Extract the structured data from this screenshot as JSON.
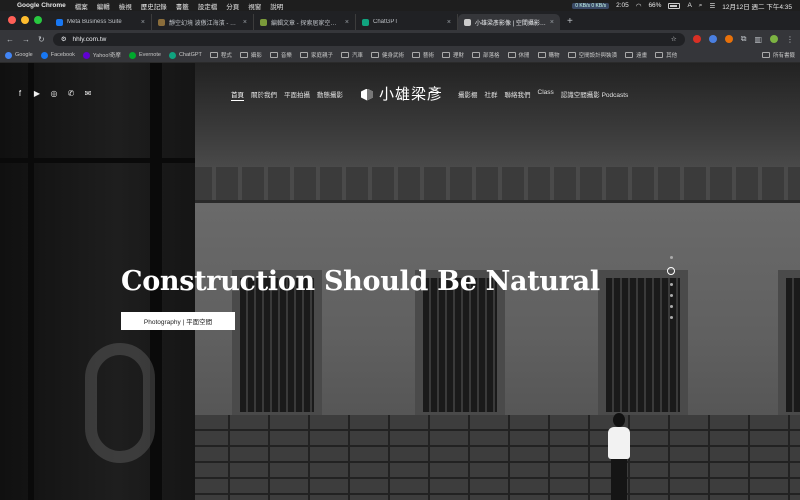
{
  "menubar": {
    "apple": "",
    "app": "Google Chrome",
    "items": [
      "檔案",
      "編輯",
      "檢視",
      "歷史記錄",
      "書籤",
      "設定檔",
      "分頁",
      "視窗",
      "說明"
    ],
    "net_speed": "0 KB/s 0 KB/s",
    "time_short": "2:05",
    "battery": "66%",
    "input_method": "A",
    "clock": "12月12日 週二 下午4:35"
  },
  "tabs": [
    {
      "title": "Meta Business Suite",
      "color": "#1877f2",
      "active": false
    },
    {
      "title": "靜空幻境 波傲江海濱 - 國內外...",
      "color": "#8a6d3b",
      "active": false
    },
    {
      "title": "編輯文章 - 探索居家空間攝影...",
      "color": "#7a9a3a",
      "active": false
    },
    {
      "title": "ChatGPT",
      "color": "#10a37f",
      "active": false
    },
    {
      "title": "小雄梁彥影像 | 空間攝影 | 室內...",
      "color": "#cccccc",
      "active": true
    }
  ],
  "omnibox": {
    "url": "hhly.com.tw"
  },
  "bookmarks": [
    {
      "label": "Google",
      "kind": "site",
      "color": "#4285f4"
    },
    {
      "label": "Facebook",
      "kind": "site",
      "color": "#1877f2"
    },
    {
      "label": "Yahoo!奇摩",
      "kind": "site",
      "color": "#6001d2"
    },
    {
      "label": "Evernote",
      "kind": "site",
      "color": "#00a82d"
    },
    {
      "label": "ChatGPT",
      "kind": "site",
      "color": "#10a37f"
    },
    {
      "label": "程式",
      "kind": "folder"
    },
    {
      "label": "攝影",
      "kind": "folder"
    },
    {
      "label": "音樂",
      "kind": "folder"
    },
    {
      "label": "家庭親子",
      "kind": "folder"
    },
    {
      "label": "汽車",
      "kind": "folder"
    },
    {
      "label": "健身武術",
      "kind": "folder"
    },
    {
      "label": "藝術",
      "kind": "folder"
    },
    {
      "label": "理財",
      "kind": "folder"
    },
    {
      "label": "部落格",
      "kind": "folder"
    },
    {
      "label": "休閒",
      "kind": "folder"
    },
    {
      "label": "購物",
      "kind": "folder"
    },
    {
      "label": "空間設計與裝潢",
      "kind": "folder"
    },
    {
      "label": "遠畫",
      "kind": "folder"
    },
    {
      "label": "其他",
      "kind": "folder"
    }
  ],
  "bookmarks_right": "所有書籤",
  "site": {
    "nav_left": [
      "首頁",
      "關於我們",
      "平面拍攝",
      "動態攝影"
    ],
    "nav_right": [
      "攝影棚",
      "社群",
      "聯絡我們",
      "Class",
      "認識空間攝影 Podcasts"
    ],
    "logo_text": "小雄梁彥",
    "hero_title": "Construction Should Be Natural",
    "hero_button": "Photography | 平面空間",
    "social_icons": [
      "facebook-icon",
      "youtube-icon",
      "instagram-icon",
      "phone-icon",
      "mail-icon"
    ]
  }
}
